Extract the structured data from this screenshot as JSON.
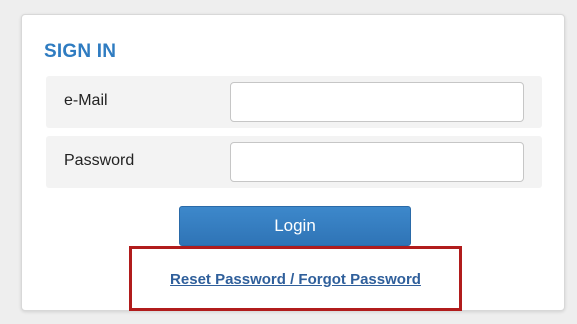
{
  "signin": {
    "title": "SIGN IN",
    "email_label": "e-Mail",
    "email_value": "",
    "password_label": "Password",
    "password_value": "",
    "login_label": "Login",
    "reset_link": "Reset Password / Forgot Password"
  },
  "colors": {
    "accent": "#2f7cc1",
    "button": "#3580c2",
    "highlight": "#b11c1c",
    "link": "#2f5f9b"
  }
}
